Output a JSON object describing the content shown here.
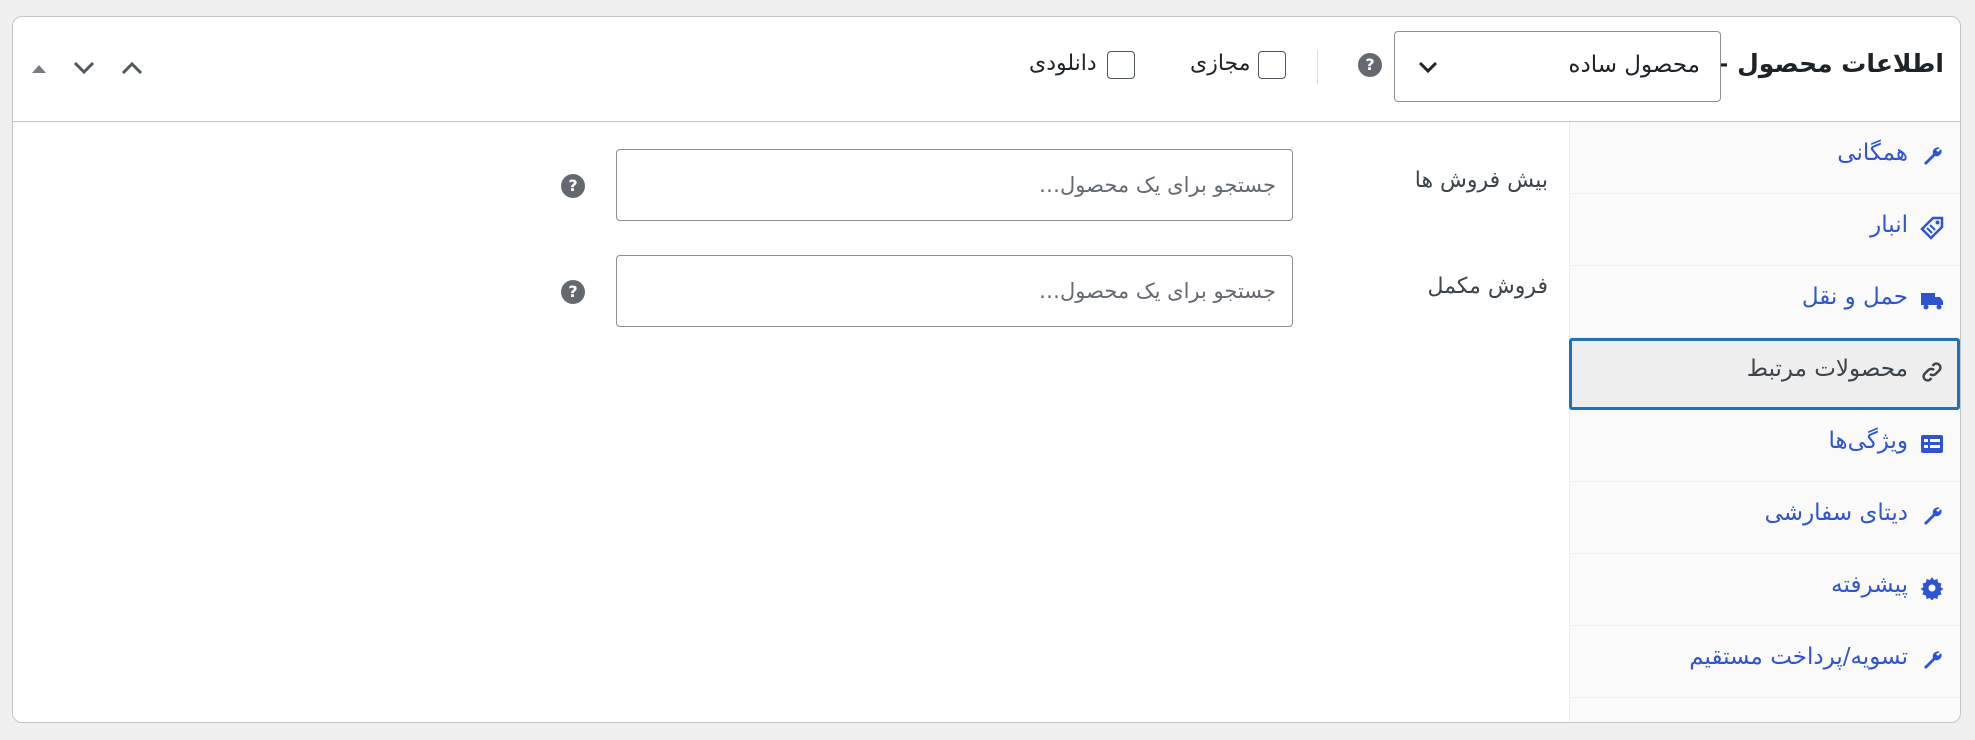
{
  "header": {
    "title": "اطلاعات محصول —",
    "product_type": "محصول ساده",
    "help_glyph": "?",
    "virtual_label": "مجازی",
    "virtual_checked": false,
    "downloadable_label": "دانلودی",
    "downloadable_checked": false
  },
  "sidebar": {
    "items": [
      {
        "label": "همگانی",
        "icon": "wrench-icon"
      },
      {
        "label": "انبار",
        "icon": "tag-icon"
      },
      {
        "label": "حمل و نقل",
        "icon": "truck-icon"
      },
      {
        "label": "محصولات مرتبط",
        "icon": "link-icon",
        "active": true
      },
      {
        "label": "ویژگی‌ها",
        "icon": "list-card-icon"
      },
      {
        "label": "دیتای سفارشی",
        "icon": "wrench-icon"
      },
      {
        "label": "پیشرفته",
        "icon": "gear-icon"
      },
      {
        "label": "تسویه/پرداخت مستقیم",
        "icon": "wrench-icon"
      }
    ]
  },
  "main": {
    "upsells_label": "بیش فروش ها",
    "cross_sells_label": "فروش مکمل",
    "search_placeholder": "جستجو برای یک محصول…"
  },
  "colors": {
    "link": "#2f54d2",
    "active_border": "#2271b1",
    "help_icon": "#646970"
  }
}
